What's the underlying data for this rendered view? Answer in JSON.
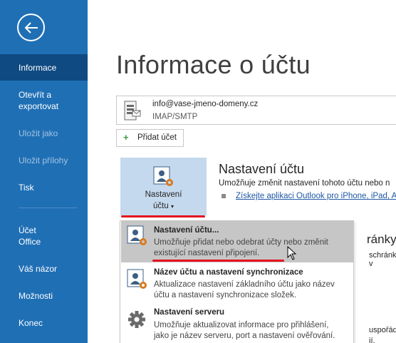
{
  "sidebar": {
    "items": [
      {
        "label": "Informace",
        "state": "active"
      },
      {
        "label": "Otevřít a",
        "label2": "exportovat",
        "state": "normal"
      },
      {
        "label": "Uložit jako",
        "state": "disabled"
      },
      {
        "label": "Uložit přílohy",
        "state": "disabled"
      },
      {
        "label": "Tisk",
        "state": "normal"
      },
      {
        "label": "Účet",
        "label2": "Office",
        "state": "normal"
      },
      {
        "label": "Váš názor",
        "state": "normal"
      },
      {
        "label": "Možnosti",
        "state": "normal"
      },
      {
        "label": "Konec",
        "state": "normal"
      }
    ]
  },
  "main": {
    "title": "Informace o účtu",
    "account": {
      "email": "info@vase-jmeno-domeny.cz",
      "type": "IMAP/SMTP"
    },
    "add_account_label": "Přidat účet",
    "settings_button": {
      "line1": "Nastavení",
      "line2": "účtu"
    },
    "section": {
      "title": "Nastavení účtu",
      "desc": "Umožňuje změnit nastavení tohoto účtu nebo n",
      "link": "Získejte aplikaci Outlook pro iPhone, iPad, A"
    },
    "background": {
      "t1": "ránky",
      "t2": "schránky v",
      "t3": "uspořádáv",
      "t4": "jí."
    }
  },
  "dropdown": {
    "items": [
      {
        "title": "Nastavení účtu...",
        "desc1": "Umožňuje přidat nebo odebrat účty nebo změnit",
        "desc2": "existující nastavení připojení."
      },
      {
        "title": "Název účtu a nastavení synchronizace",
        "desc1": "Aktualizace nastavení základního účtu jako název",
        "desc2": "účtu a nastavení synchronizace složek."
      },
      {
        "title": "Nastavení serveru",
        "desc1": "Umožňuje aktualizovat informace pro přihlášení,",
        "desc2": "jako je název serveru, port a nastavení ověřování."
      }
    ]
  },
  "colors": {
    "sidebar": "#1f6fb5",
    "sidebar_active": "#104a82",
    "highlight": "#e3121f",
    "menu_hover": "#c6c6c6"
  }
}
